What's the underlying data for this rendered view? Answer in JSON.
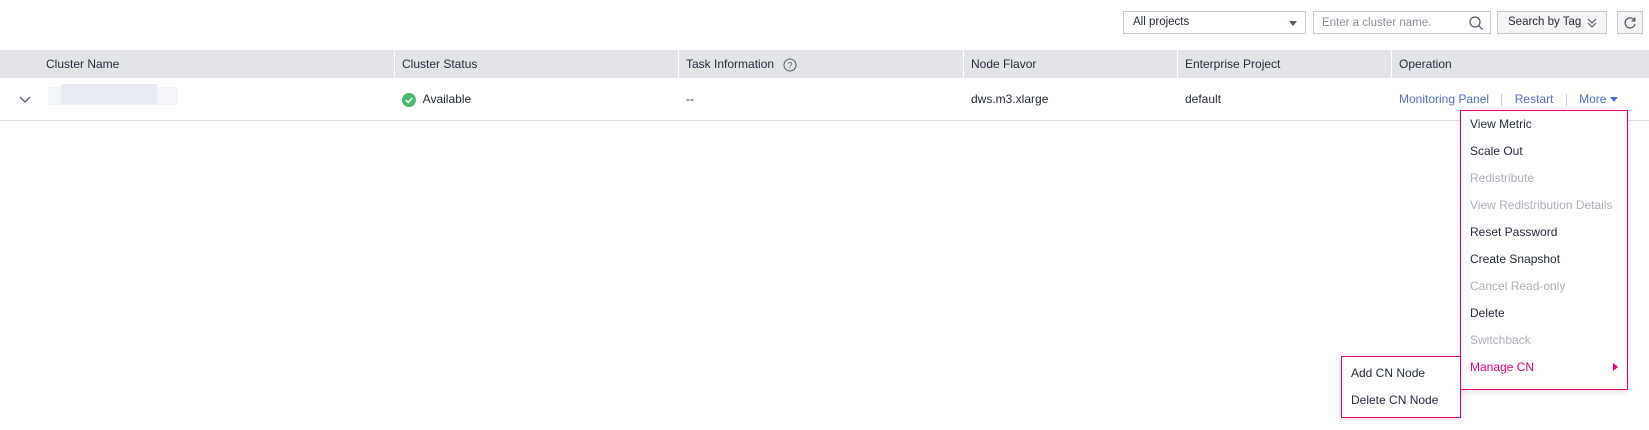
{
  "toolbar": {
    "project_select": "All projects",
    "search_placeholder": "Enter a cluster name.",
    "search_by_tag_label": "Search by Tag"
  },
  "table": {
    "columns": [
      "Cluster Name",
      "Cluster Status",
      "Task Information",
      "Node Flavor",
      "Enterprise Project",
      "Operation"
    ],
    "rows": [
      {
        "cluster_name": "",
        "status": "Available",
        "task_information": "--",
        "node_flavor": "dws.m3.xlarge",
        "enterprise_project": "default",
        "operations": [
          "Monitoring Panel",
          "Restart",
          "More"
        ]
      }
    ]
  },
  "more_menu": {
    "items": [
      {
        "label": "View Metric",
        "state": "enabled"
      },
      {
        "label": "Scale Out",
        "state": "enabled"
      },
      {
        "label": "Redistribute",
        "state": "disabled"
      },
      {
        "label": "View Redistribution Details",
        "state": "disabled"
      },
      {
        "label": "Reset Password",
        "state": "enabled"
      },
      {
        "label": "Create Snapshot",
        "state": "enabled"
      },
      {
        "label": "Cancel Read-only",
        "state": "disabled"
      },
      {
        "label": "Delete",
        "state": "enabled"
      },
      {
        "label": "Switchback",
        "state": "disabled"
      },
      {
        "label": "Manage CN",
        "state": "active"
      }
    ]
  },
  "submenu": {
    "items": [
      "Add CN Node",
      "Delete CN Node"
    ]
  },
  "colors": {
    "link": "#526ecc",
    "highlight": "#e6007e",
    "status_available": "#50b86e",
    "header_bg": "#e2e4e8",
    "disabled_text": "#adb0b8"
  },
  "icons": [
    "search-icon",
    "chevron-double-down-icon",
    "refresh-icon",
    "help-icon",
    "expand-chevron-icon",
    "status-available-icon",
    "caret-down-icon",
    "caret-right-icon"
  ]
}
